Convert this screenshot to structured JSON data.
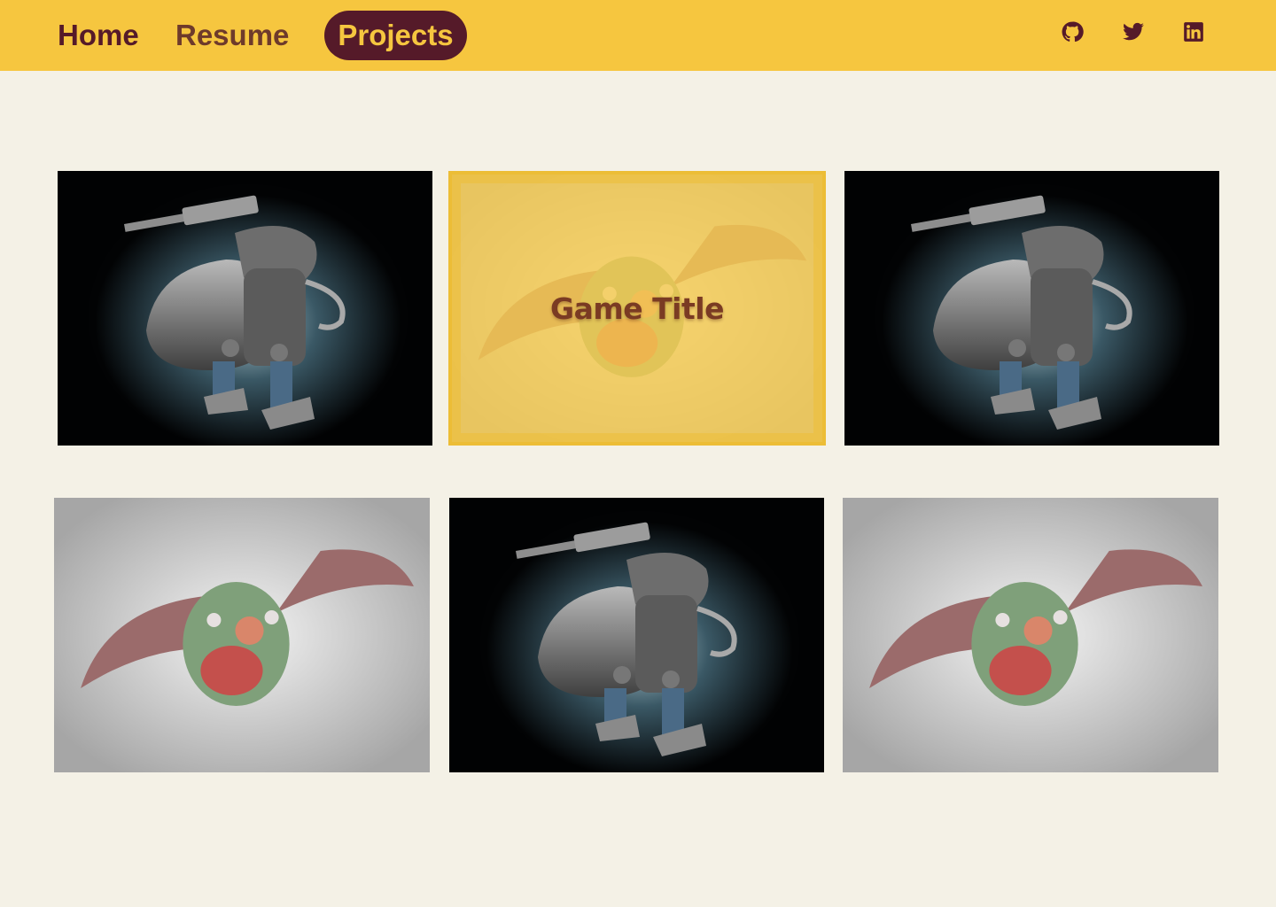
{
  "nav": {
    "home": "Home",
    "resume": "Resume",
    "projects": "Projects",
    "active": "projects"
  },
  "social": {
    "github_icon": "github-icon",
    "twitter_icon": "twitter-icon",
    "linkedin_icon": "linkedin-icon"
  },
  "colors": {
    "header_bg": "#f6c63f",
    "accent": "#551a29",
    "page_bg": "#f4f1e6"
  },
  "projects": [
    {
      "image": "robot-artwork"
    },
    {
      "image": "bat-creature-artwork",
      "hover_title": "Game Title"
    },
    {
      "image": "robot-artwork"
    },
    {
      "image": "bat-creature-artwork"
    },
    {
      "image": "robot-artwork"
    },
    {
      "image": "bat-creature-artwork"
    }
  ]
}
